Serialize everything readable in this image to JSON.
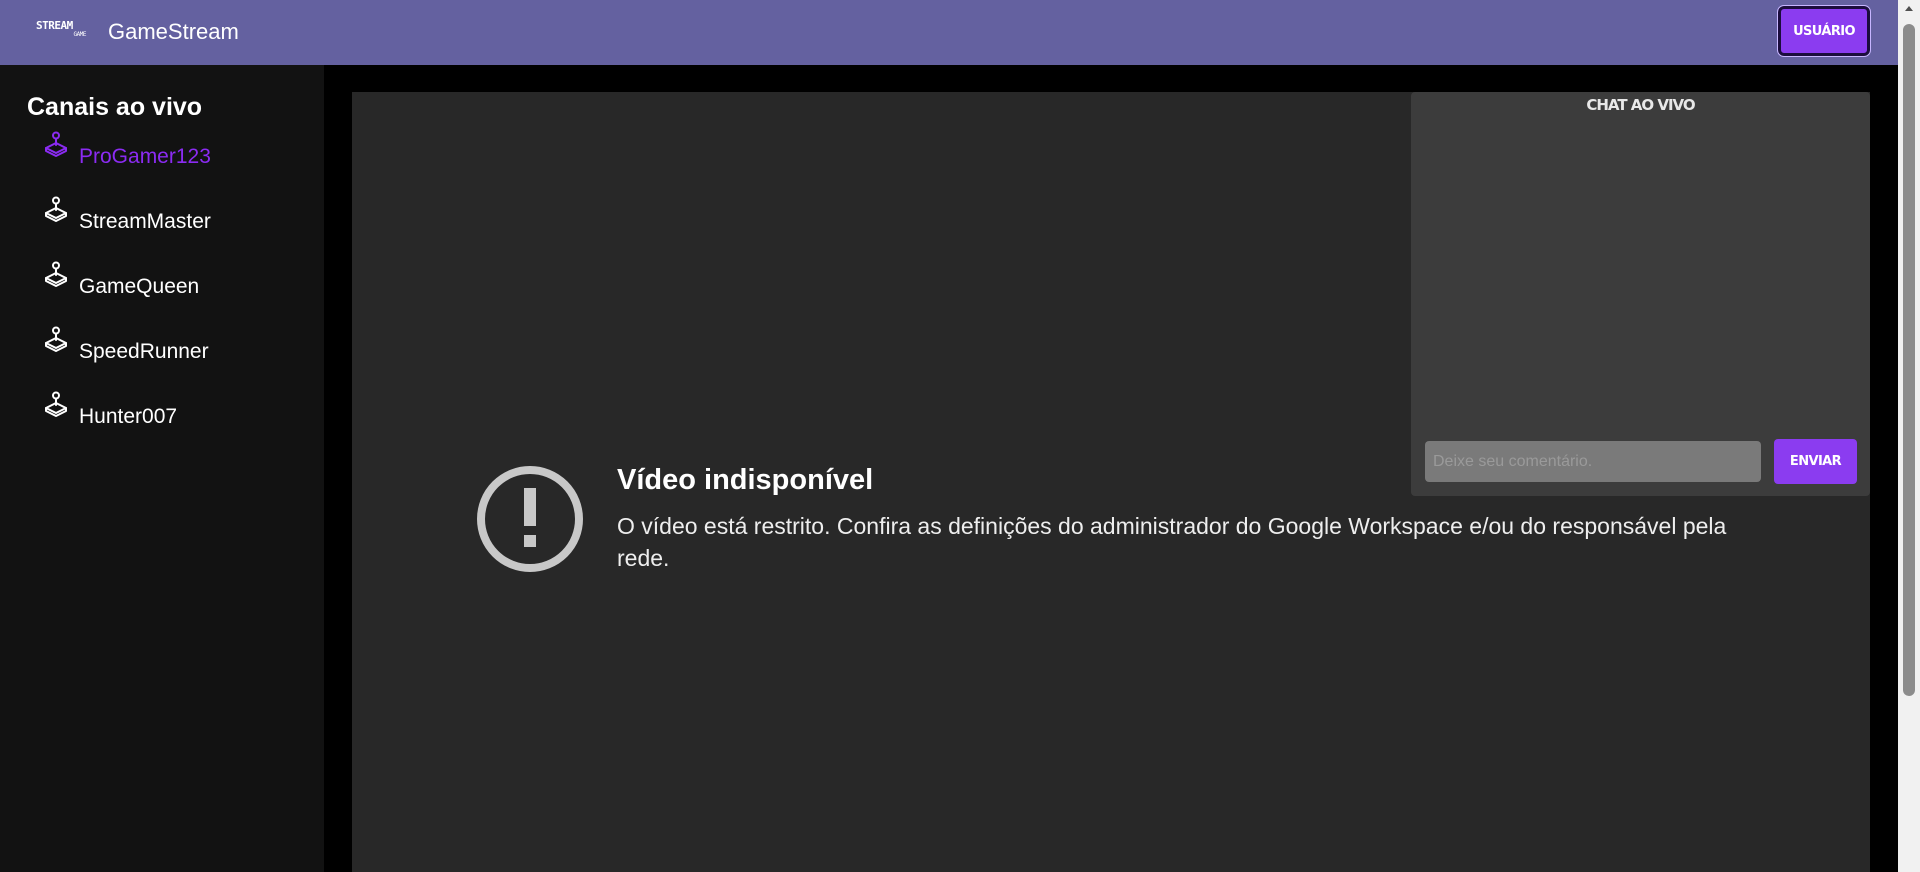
{
  "header": {
    "logo_text": "STREAM",
    "logo_subtext": "GAME",
    "app_title": "GameStream",
    "user_button_label": "USUÁRIO"
  },
  "sidebar": {
    "title": "Canais ao vivo",
    "channels": [
      {
        "name": "ProGamer123",
        "active": true,
        "icon": "joystick-icon"
      },
      {
        "name": "StreamMaster",
        "active": false,
        "icon": "joystick-icon"
      },
      {
        "name": "GameQueen",
        "active": false,
        "icon": "joystick-icon"
      },
      {
        "name": "SpeedRunner",
        "active": false,
        "icon": "joystick-icon"
      },
      {
        "name": "Hunter007",
        "active": false,
        "icon": "joystick-icon"
      }
    ]
  },
  "player": {
    "error_icon": "exclamation-circle-icon",
    "error_title": "Vídeo indisponível",
    "error_message": "O vídeo está restrito. Confira as definições do administrador do Google Workspace e/ou do responsável pela rede."
  },
  "chat": {
    "title": "CHAT AO VIVO",
    "input_placeholder": "Deixe seu comentário.",
    "send_label": "ENVIAR"
  },
  "colors": {
    "header_bg": "#6461a0",
    "accent": "#8b3cf0",
    "active_channel": "#8b2bf2",
    "sidebar_bg": "#121212",
    "player_bg": "#282828",
    "chat_bg": "#3c3c3c"
  }
}
